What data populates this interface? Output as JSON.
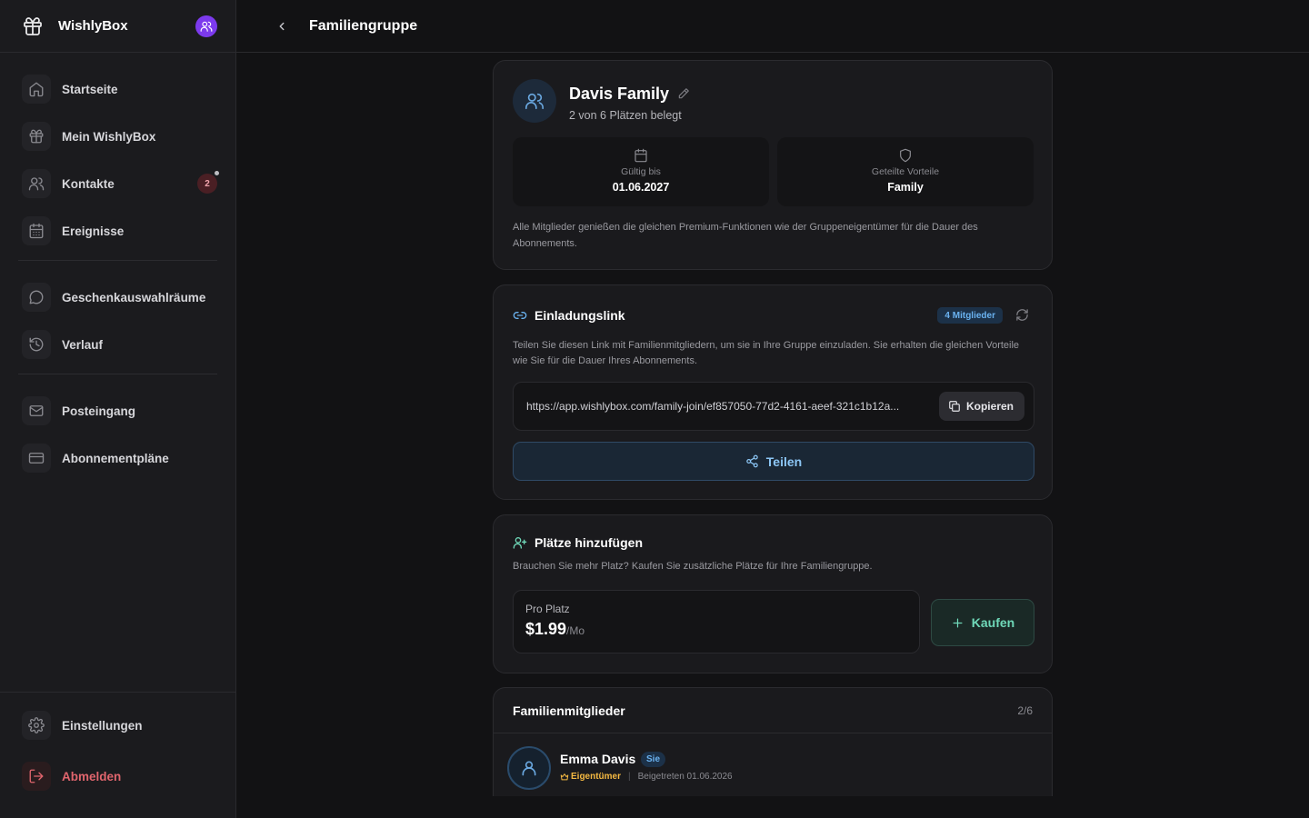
{
  "app": {
    "name": "WishlyBox"
  },
  "sidebar": {
    "items": [
      {
        "label": "Startseite",
        "icon": "home-icon"
      },
      {
        "label": "Mein WishlyBox",
        "icon": "gift-icon"
      },
      {
        "label": "Kontakte",
        "icon": "users-icon",
        "badge": "2"
      },
      {
        "label": "Ereignisse",
        "icon": "calendar-icon"
      },
      {
        "label": "Geschenkauswahlräume",
        "icon": "chat-icon"
      },
      {
        "label": "Verlauf",
        "icon": "history-icon"
      },
      {
        "label": "Posteingang",
        "icon": "mail-icon"
      },
      {
        "label": "Abonnementpläne",
        "icon": "credit-card-icon"
      }
    ],
    "bottom": {
      "settings": "Einstellungen",
      "logout": "Abmelden"
    }
  },
  "header": {
    "title": "Familiengruppe"
  },
  "group": {
    "name": "Davis Family",
    "seats": "2 von 6 Plätzen belegt",
    "valid_label": "Gültig bis",
    "valid_value": "01.06.2027",
    "benefits_label": "Geteilte Vorteile",
    "benefits_value": "Family",
    "note": "Alle Mitglieder genießen die gleichen Premium-Funktionen wie der Gruppeneigentümer für die Dauer des Abonnements."
  },
  "invite": {
    "title": "Einladungslink",
    "members_badge": "4 Mitglieder",
    "description": "Teilen Sie diesen Link mit Familienmitgliedern, um sie in Ihre Gruppe einzuladen. Sie erhalten die gleichen Vorteile wie Sie für die Dauer Ihres Abonnements.",
    "link": "https://app.wishlybox.com/family-join/ef857050-77d2-4161-aeef-321c1b12a...",
    "copy_label": "Kopieren",
    "share_label": "Teilen"
  },
  "add_seats": {
    "title": "Plätze hinzufügen",
    "description": "Brauchen Sie mehr Platz? Kaufen Sie zusätzliche Plätze für Ihre Familiengruppe.",
    "price_label": "Pro Platz",
    "price": "$1.99",
    "price_unit": "/Mo",
    "buy_label": "Kaufen"
  },
  "members": {
    "title": "Familienmitglieder",
    "count": "2/6",
    "list": [
      {
        "name": "Emma Davis",
        "badge": "Sie",
        "role": "Eigentümer",
        "joined": "Beigetreten 01.06.2026"
      }
    ]
  },
  "colors": {
    "accent_blue": "#6ab2f0",
    "accent_green": "#6fd8b8",
    "owner_gold": "#f5b942",
    "logout_red": "#e0656d",
    "avatar_purple": "#7c3aed"
  }
}
